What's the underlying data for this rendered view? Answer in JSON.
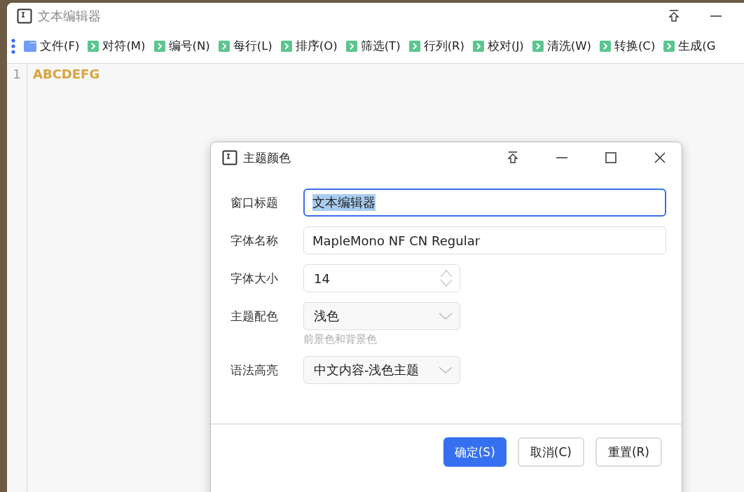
{
  "window": {
    "title": "文本编辑器"
  },
  "menu": [
    {
      "label": "文件(F)",
      "kind": "file"
    },
    {
      "label": "对符(M)",
      "kind": "arrow"
    },
    {
      "label": "编号(N)",
      "kind": "arrow"
    },
    {
      "label": "每行(L)",
      "kind": "arrow"
    },
    {
      "label": "排序(O)",
      "kind": "arrow"
    },
    {
      "label": "筛选(T)",
      "kind": "arrow"
    },
    {
      "label": "行列(R)",
      "kind": "arrow"
    },
    {
      "label": "校对(J)",
      "kind": "arrow"
    },
    {
      "label": "清洗(W)",
      "kind": "arrow"
    },
    {
      "label": "转换(C)",
      "kind": "arrow"
    },
    {
      "label": "生成(G",
      "kind": "arrow"
    }
  ],
  "editor": {
    "lines": [
      {
        "number": "1",
        "text": "ABCDEFG"
      }
    ]
  },
  "dialog": {
    "title": "主题颜色",
    "fields": [
      {
        "label": "窗口标题",
        "kind": "text",
        "value": "文本编辑器",
        "focused": true
      },
      {
        "label": "字体名称",
        "kind": "text",
        "value": "MapleMono NF CN Regular",
        "focused": false
      },
      {
        "label": "字体大小",
        "kind": "spin",
        "value": "14"
      },
      {
        "label": "主题配色",
        "kind": "select",
        "value": "浅色",
        "hint": "前景色和背景色"
      },
      {
        "label": "语法高亮",
        "kind": "select",
        "value": "中文内容-浅色主题"
      }
    ],
    "buttons": [
      {
        "label": "确定(S)",
        "kind": "primary"
      },
      {
        "label": "取消(C)",
        "kind": "default"
      },
      {
        "label": "重置(R)",
        "kind": "default"
      }
    ]
  }
}
